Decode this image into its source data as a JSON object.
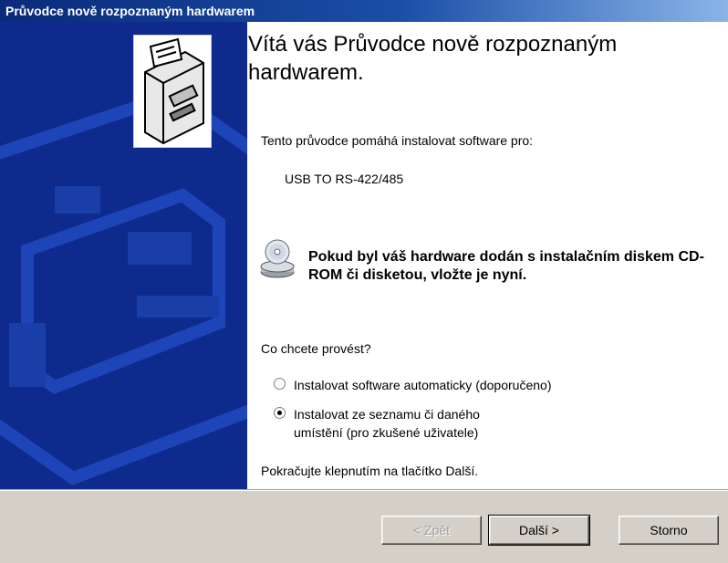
{
  "window": {
    "title": "Průvodce nově rozpoznaným hardwarem"
  },
  "content": {
    "heading": "Vítá vás Průvodce nově rozpoznaným hardwarem.",
    "intro": "Tento průvodce pomáhá instalovat software pro:",
    "device_name": "USB TO RS-422/485",
    "cd_notice": "Pokud byl váš hardware dodán s instalačním diskem CD-ROM či disketou, vložte je nyní.",
    "question": "Co chcete provést?",
    "options": [
      {
        "label": "Instalovat software automaticky (doporučeno)",
        "selected": false
      },
      {
        "label": "Instalovat ze seznamu či daného umístění (pro zkušené uživatele)",
        "selected": true
      }
    ],
    "continue_hint": "Pokračujte klepnutím na tlačítko Další."
  },
  "buttons": {
    "back": "< Zpět",
    "next": "Další >",
    "cancel": "Storno"
  },
  "colors": {
    "side_panel": "#0d2a8c",
    "titlebar_start": "#0a2a7a",
    "footer": "#d4d0c8"
  },
  "icons": {
    "wizard": "hardware-card-icon",
    "media": "cd-rom-icon"
  }
}
